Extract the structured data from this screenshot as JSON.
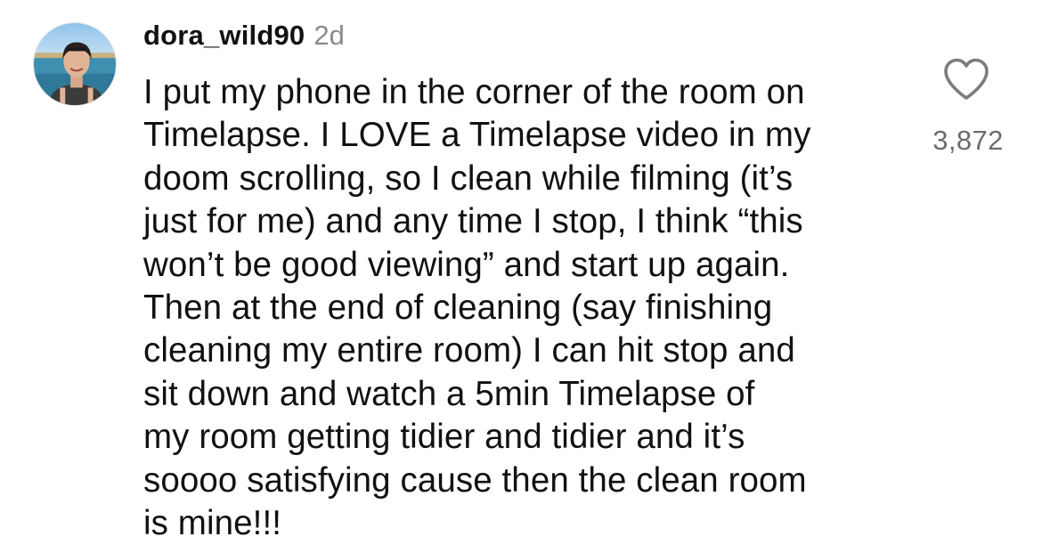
{
  "comment": {
    "username": "dora_wild90",
    "timestamp": "2d",
    "avatar_icon": "profile-photo",
    "text_lines": [
      "I put my phone in the corner of the room on",
      "Timelapse. I LOVE a Timelapse video in my",
      "doom scrolling, so I clean while filming (it’s",
      "just for me) and any time I stop, I think “this",
      "won’t be good viewing” and start up again.",
      "Then at the end of cleaning (say finishing",
      "cleaning my entire room) I can hit stop and",
      "sit down and watch a 5min Timelapse of",
      "my room getting tidier and tidier and it’s",
      "soooo satisfying cause then the clean room",
      "is mine!!!"
    ],
    "like_icon": "heart-outline-icon",
    "like_count": "3,872"
  },
  "colors": {
    "text": "#111111",
    "muted": "#8a8a8e",
    "count": "#6c6c70",
    "icon": "#7c7c80"
  }
}
